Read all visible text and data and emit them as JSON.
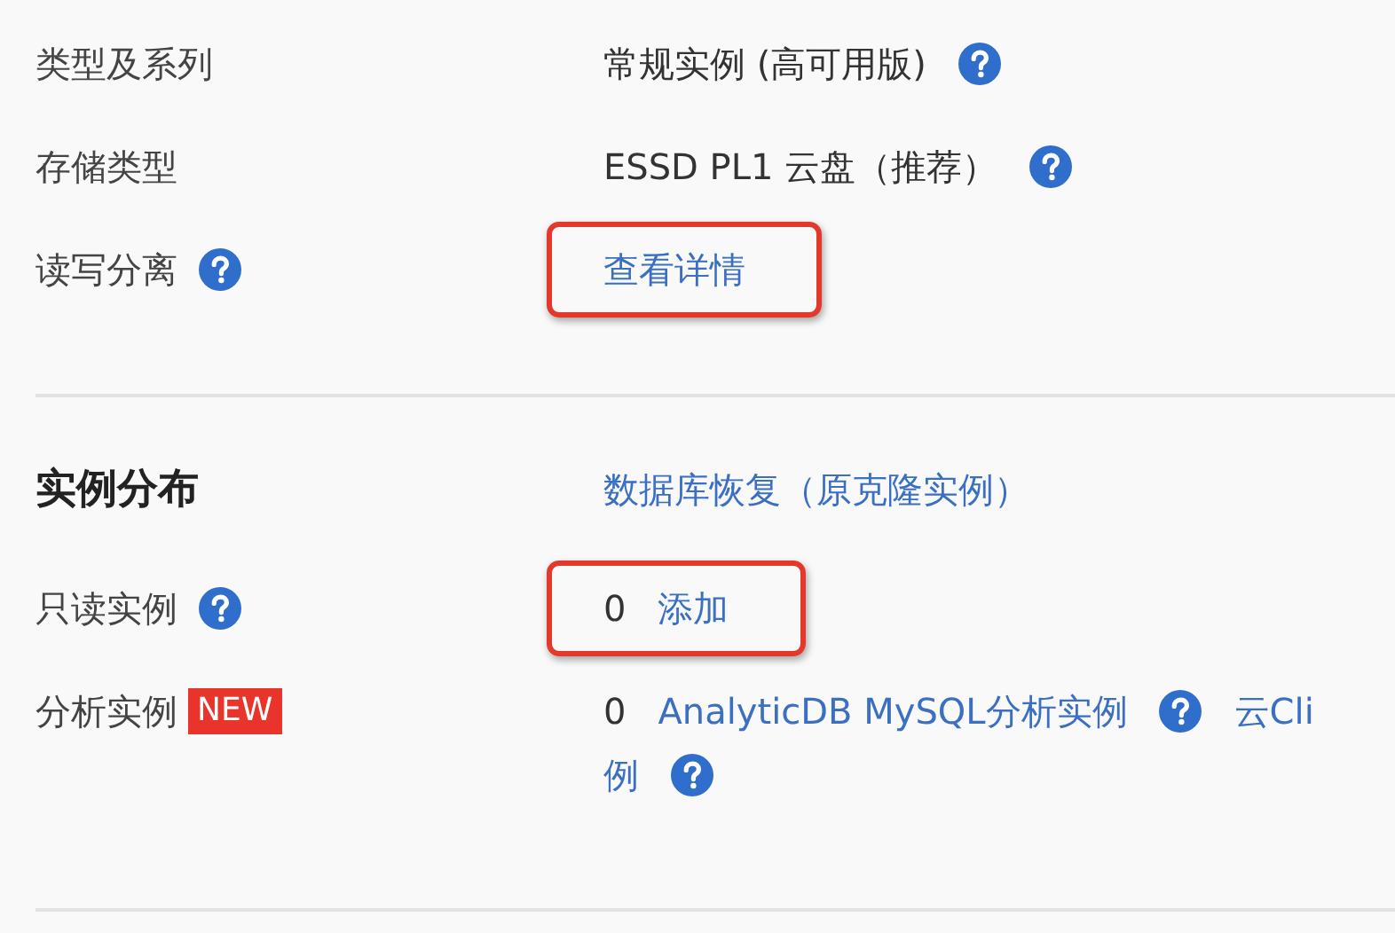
{
  "sections": [
    {
      "rows": [
        {
          "label": "类型及系列",
          "label_help": false,
          "highlighted": false,
          "items": [
            {
              "kind": "text",
              "text": "常规实例 (高可用版)"
            },
            {
              "kind": "help"
            }
          ]
        },
        {
          "label": "存储类型",
          "label_help": false,
          "highlighted": false,
          "items": [
            {
              "kind": "text",
              "text": "ESSD PL1 云盘（推荐）"
            },
            {
              "kind": "help"
            }
          ]
        },
        {
          "label": "读写分离",
          "label_help": true,
          "highlighted": true,
          "items": [
            {
              "kind": "link",
              "text": "查看详情"
            }
          ]
        }
      ]
    },
    {
      "title": "实例分布",
      "header_link": "数据库恢复（原克隆实例）",
      "rows": [
        {
          "label": "只读实例",
          "label_help": true,
          "highlighted": true,
          "items": [
            {
              "kind": "text",
              "text": "0"
            },
            {
              "kind": "link",
              "text": "添加"
            }
          ]
        },
        {
          "label": "分析实例",
          "label_help": false,
          "badge": "NEW",
          "highlighted": false,
          "items": [
            {
              "kind": "text",
              "text": "0"
            },
            {
              "kind": "link",
              "text": "AnalyticDB MySQL分析实例"
            },
            {
              "kind": "help"
            },
            {
              "kind": "link",
              "text": "云Cli"
            },
            {
              "kind": "break"
            },
            {
              "kind": "link",
              "text": "例"
            },
            {
              "kind": "help"
            }
          ]
        }
      ]
    }
  ]
}
